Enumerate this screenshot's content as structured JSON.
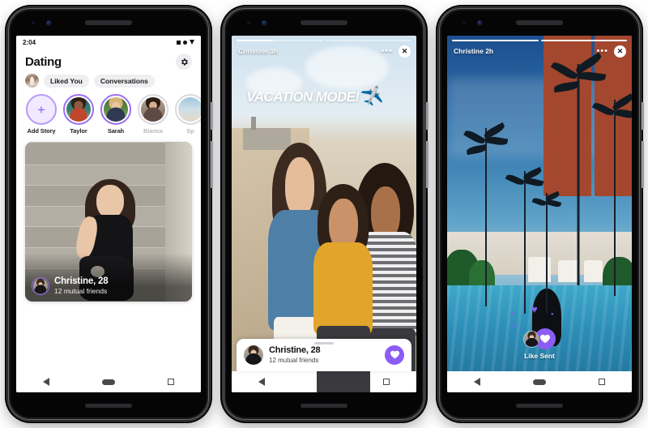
{
  "phones": [
    {
      "id": "phone-dating-home",
      "status_bar": {
        "time": "2:04",
        "icons": [
          "square-icon",
          "wifi-icon",
          "battery-icon"
        ]
      },
      "header": {
        "title": "Dating",
        "settings_icon": "gear-icon"
      },
      "filters": [
        {
          "label": "Liked You"
        },
        {
          "label": "Conversations"
        }
      ],
      "stories": [
        {
          "label": "Add Story",
          "type": "add",
          "state": "new"
        },
        {
          "label": "Taylor",
          "type": "user",
          "state": "unseen"
        },
        {
          "label": "Sarah",
          "type": "user",
          "state": "unseen"
        },
        {
          "label": "Bianca",
          "type": "user",
          "state": "seen"
        },
        {
          "label": "Sp",
          "type": "user",
          "state": "seen"
        }
      ],
      "card": {
        "name": "Christine, 28",
        "mutual": "12 mutual friends",
        "photo_alt": "woman-sitting-on-stairs"
      },
      "nav": [
        "back-button",
        "home-button",
        "recents-button"
      ]
    },
    {
      "id": "phone-story-beach",
      "story": {
        "user": "Christine 3h",
        "more_icon": "more-dots-icon",
        "close_icon": "close-icon",
        "progress": [
          0.42,
          0
        ],
        "sticker_text": "VACATION MODE!",
        "sticker_emoji": "✈️",
        "photo_alt": "three-friends-hugging-on-beach"
      },
      "sheet": {
        "name": "Christine, 28",
        "mutual": "12 mutual friends",
        "action_icon": "heart-icon"
      },
      "nav": [
        "back-button",
        "home-button",
        "recents-button"
      ]
    },
    {
      "id": "phone-story-pool",
      "story": {
        "user": "Christine 2h",
        "more_icon": "more-dots-icon",
        "close_icon": "close-icon",
        "progress": [
          1,
          1
        ],
        "photo_alt": "tropical-resort-pool-with-palm-trees"
      },
      "like_sent": {
        "label": "Like Sent",
        "icon": "heart-icon"
      },
      "nav": [
        "back-button",
        "home-button",
        "recents-button"
      ]
    }
  ],
  "colors": {
    "accent_purple": "#8b5cf6",
    "ring_purple": "#9b6ef3",
    "ring_seen": "#d9d9de",
    "pill_bg": "#efeff1",
    "text_dark": "#111111",
    "phone_body": "#1b1b1d"
  }
}
